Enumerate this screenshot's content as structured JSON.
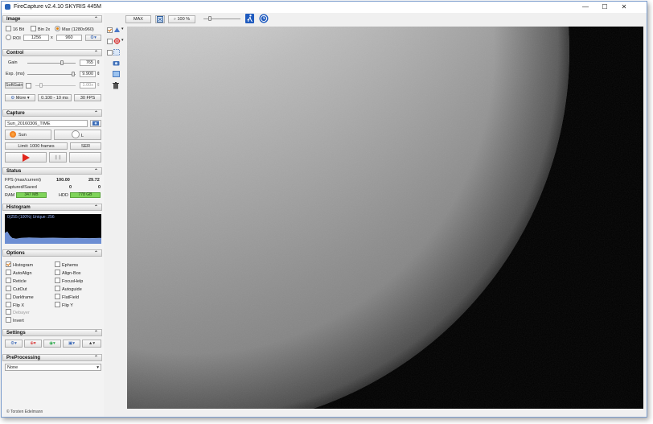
{
  "window": {
    "title": "FireCapture v2.4.10    SKYRIS 445M",
    "controls": {
      "minimize": "—",
      "maximize": "☐",
      "close": "✕"
    }
  },
  "toolbar": {
    "max_label": "MAX",
    "zoom_label": "100 %",
    "zoom_slider_fraction": 0.15
  },
  "image": {
    "header": "Image",
    "bit16_label": "16 Bit",
    "bin_label": "Bin 2x",
    "max_label": "Max (1280x960)",
    "roi_label": "ROI",
    "roi_width": "1256",
    "roi_x": "x",
    "roi_height": "960"
  },
  "control": {
    "header": "Control",
    "gain_label": "Gain",
    "gain_value": "765",
    "gain_fraction": 0.73,
    "exp_label": "Exp. (ms)",
    "exp_value": "9.900",
    "exp_fraction": 0.98,
    "softgain_label": "SoftGain",
    "softgain_value": "1.00x",
    "softgain_fraction": 0.1,
    "more_label": "More",
    "range_label": "0.100 - 10 ms",
    "fps_label": "30 FPS"
  },
  "capture": {
    "header": "Capture",
    "filename": "Sun_20160306_TIME",
    "profile_label": "Sun",
    "toggle_label": "L",
    "limit_label": "Limit: 1000 frames",
    "format_label": "SER"
  },
  "status": {
    "header": "Status",
    "fps_label": "FPS (max/current)",
    "fps_max": "100.00",
    "fps_current": "29.72",
    "captured_label": "Captured/Saved",
    "captured": "0",
    "saved": "0",
    "ram_label": "RAM",
    "ram_value": "347 MB",
    "hdd_label": "HDD",
    "hdd_value": "778 GB"
  },
  "histogram": {
    "header": "Histogram",
    "info": "0(255 (100%)  Unique: 256"
  },
  "options": {
    "header": "Options",
    "left": [
      {
        "label": "Histogram",
        "checked": true
      },
      {
        "label": "AutoAlign",
        "checked": false
      },
      {
        "label": "Reticle",
        "checked": false
      },
      {
        "label": "CutOut",
        "checked": false
      },
      {
        "label": "Darkframe",
        "checked": false
      },
      {
        "label": "Flip X",
        "checked": false
      },
      {
        "label": "Debayer",
        "checked": false
      },
      {
        "label": "Invert",
        "checked": false
      }
    ],
    "right": [
      {
        "label": "Ephems",
        "checked": false
      },
      {
        "label": "Align-Box",
        "checked": false
      },
      {
        "label": "FocusHelp",
        "checked": false
      },
      {
        "label": "Autoguide",
        "checked": false
      },
      {
        "label": "FlatField",
        "checked": false
      },
      {
        "label": "Flip Y",
        "checked": false
      }
    ]
  },
  "settings": {
    "header": "Settings"
  },
  "preprocessing": {
    "header": "PreProcessing",
    "selected": "None"
  },
  "statusbar": {
    "text": "© Torsten Edelmann"
  }
}
